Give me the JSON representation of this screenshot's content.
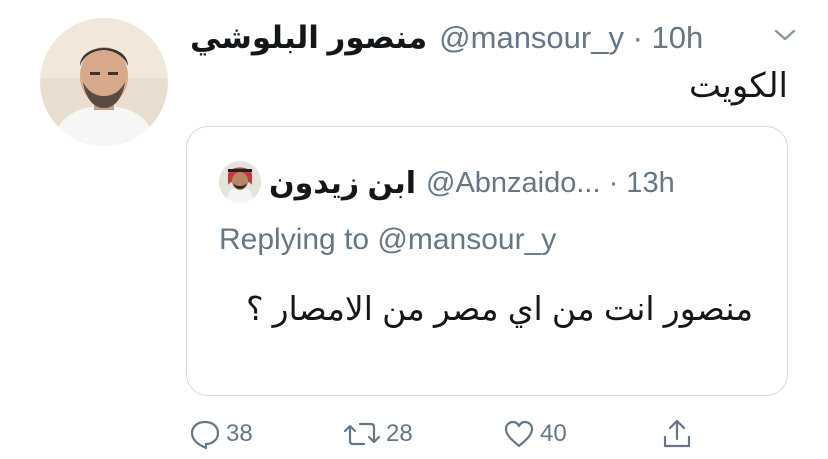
{
  "tweet": {
    "author_name": "منصور البلوشي",
    "handle_time": "@mansour_y · 10h",
    "text": "الكويت",
    "icons": {
      "avatar": "profile-photo",
      "caret": "chevron-down-icon"
    }
  },
  "quoted_tweet": {
    "author_name": "ابن زيدون",
    "handle_time": "@Abnzaido... · 13h",
    "replying_to": "Replying to @mansour_y",
    "text": "منصور انت من اي مصر من الامصار ؟"
  },
  "actions": {
    "reply_count": "38",
    "retweet_count": "28",
    "like_count": "40",
    "icons": [
      "reply-icon",
      "retweet-icon",
      "like-icon",
      "share-icon"
    ]
  },
  "colors": {
    "text": "#14171a",
    "muted": "#657786",
    "border": "#cfd9de"
  }
}
